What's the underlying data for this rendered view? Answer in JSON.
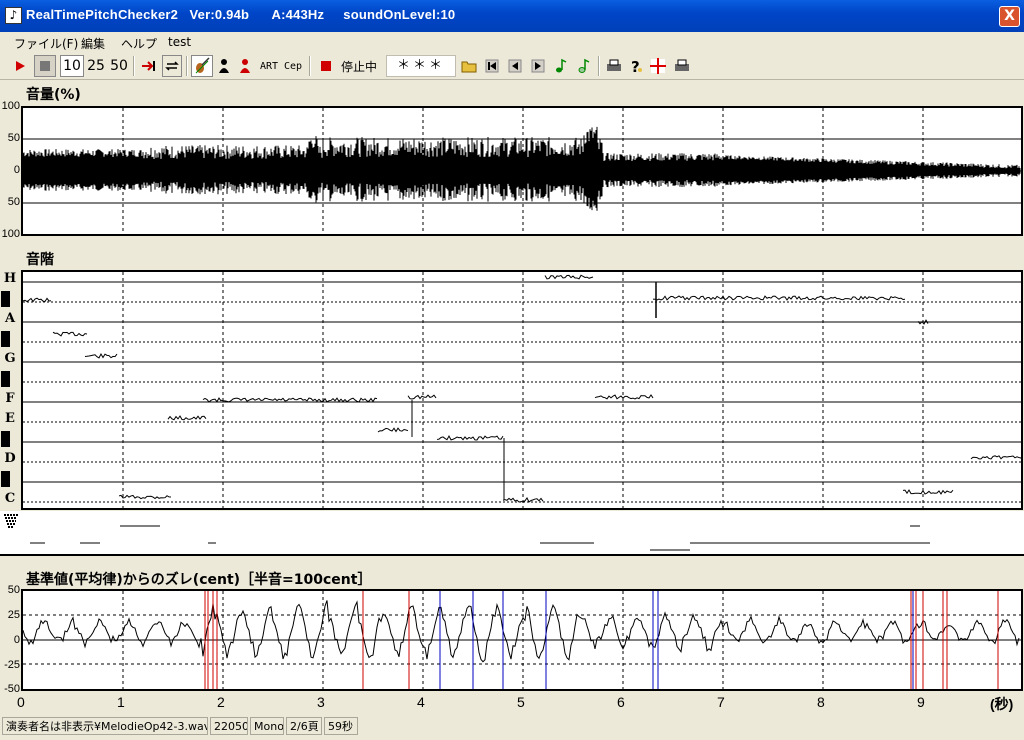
{
  "window": {
    "title": "RealTimePitchChecker2   Ver:0.94b      A:443Hz     soundOnLevel:10",
    "close": "X"
  },
  "menu": [
    "ファイル(F)",
    "編集",
    "ヘルプ",
    "test"
  ],
  "toolbar": {
    "numbers": [
      "10",
      "25",
      "50"
    ],
    "art": "ART",
    "cep": "Cep",
    "stop_status": "停止中",
    "display": "＊＊＊"
  },
  "panels": {
    "volume": {
      "title": "音量(%)",
      "yticks": [
        "100",
        "50",
        "0",
        "50",
        "100"
      ]
    },
    "scale": {
      "title": "音階",
      "notes": [
        "H",
        "A",
        "G",
        "F",
        "E",
        "D",
        "C"
      ]
    },
    "cent": {
      "title": "基準値(平均律)からのズレ(cent)［半音=100cent］",
      "yticks": [
        "50",
        "25",
        "0",
        "-25",
        "-50"
      ]
    }
  },
  "xaxis": {
    "ticks": [
      "0",
      "1",
      "2",
      "3",
      "4",
      "5",
      "6",
      "7",
      "8",
      "9"
    ],
    "unit": "(秒)"
  },
  "statusbar": {
    "file": "演奏者名は非表示¥MelodieOp42-3.wav",
    "rate": "22050",
    "channel": "Mono",
    "page": "2/6頁",
    "length": "59秒"
  },
  "colors": {
    "title_bar": "#0a5fe0",
    "accent_red": "#d00000",
    "accent_blue": "#0000c0"
  }
}
